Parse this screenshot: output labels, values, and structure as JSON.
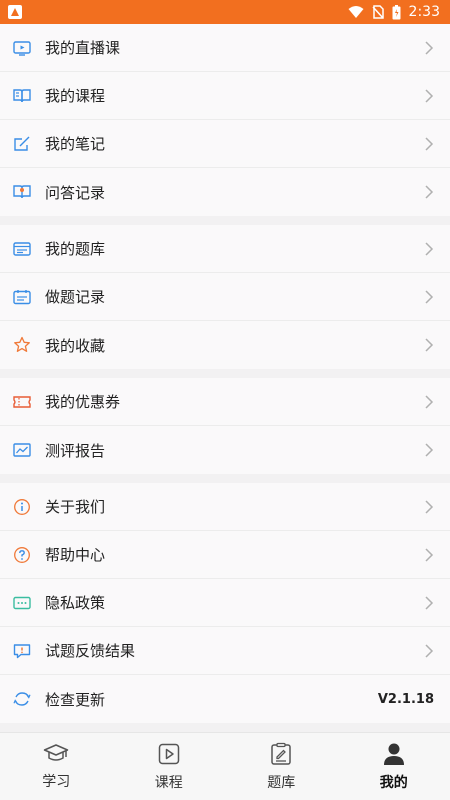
{
  "status_bar": {
    "time": "2:33",
    "bar_color": "#f26f1f"
  },
  "menu": {
    "groups": [
      {
        "items": [
          {
            "label": "我的直播课",
            "icon": "live-tv-icon",
            "icon_color": "#3a8ee6"
          },
          {
            "label": "我的课程",
            "icon": "open-book-icon",
            "icon_color": "#3a8ee6"
          },
          {
            "label": "我的笔记",
            "icon": "pen-note-icon",
            "icon_color": "#3a8ee6"
          },
          {
            "label": "问答记录",
            "icon": "qa-book-icon",
            "icon_color": "#3a8ee6"
          }
        ]
      },
      {
        "items": [
          {
            "label": "我的题库",
            "icon": "question-bank-icon",
            "icon_color": "#3a8ee6"
          },
          {
            "label": "做题记录",
            "icon": "calendar-record-icon",
            "icon_color": "#3a8ee6"
          },
          {
            "label": "我的收藏",
            "icon": "star-icon",
            "icon_color": "#f07a3a"
          }
        ]
      },
      {
        "items": [
          {
            "label": "我的优惠券",
            "icon": "ticket-icon",
            "icon_color": "#e85c35"
          },
          {
            "label": "测评报告",
            "icon": "chart-report-icon",
            "icon_color": "#3a8ee6"
          }
        ]
      },
      {
        "items": [
          {
            "label": "关于我们",
            "icon": "info-icon",
            "icon_color": "#f07a3a"
          },
          {
            "label": "帮助中心",
            "icon": "help-icon",
            "icon_color": "#f07a3a"
          },
          {
            "label": "隐私政策",
            "icon": "privacy-icon",
            "icon_color": "#3abda0"
          },
          {
            "label": "试题反馈结果",
            "icon": "feedback-icon",
            "icon_color": "#3a8ee6"
          },
          {
            "label": "检查更新",
            "icon": "refresh-icon",
            "icon_color": "#3a8ee6",
            "value": "V2.1.18"
          }
        ]
      }
    ]
  },
  "bottom_nav": {
    "tabs": [
      {
        "label": "学习",
        "icon": "graduation-cap-icon",
        "active": false
      },
      {
        "label": "课程",
        "icon": "play-course-icon",
        "active": false
      },
      {
        "label": "题库",
        "icon": "exam-paper-icon",
        "active": false
      },
      {
        "label": "我的",
        "icon": "user-profile-icon",
        "active": true
      }
    ]
  }
}
